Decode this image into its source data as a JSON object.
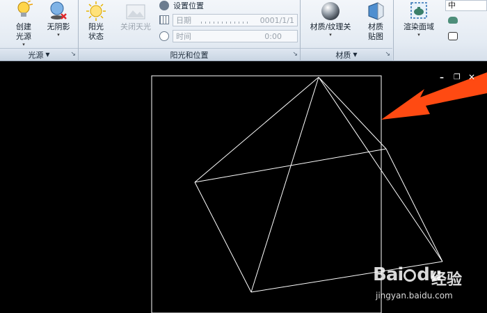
{
  "ribbon": {
    "light_panel": {
      "title": "光源",
      "create_light": "创建\n光源",
      "no_shadow": "无阴影"
    },
    "sun_panel": {
      "title": "阳光和位置",
      "sun_status": "阳光\n状态",
      "sky_off": "关闭天光",
      "set_location": "设置位置",
      "date_label": "日期",
      "date_value": "0001/1/1",
      "time_label": "时间",
      "time_value": "0:00"
    },
    "material_panel": {
      "title": "材质",
      "materials_textures": "材质/纹理关",
      "material_mapping": "材质\n贴图"
    },
    "render_panel": {
      "render_region": "渲染面域",
      "quality_value": "中"
    }
  },
  "viewport": {
    "controls": {
      "minimize": "–",
      "restore": "❐",
      "close": "✕"
    }
  },
  "watermark": {
    "logo": "Bai",
    "logo_du": "du",
    "brand": "经验",
    "url": "jingyan.baidu.com"
  },
  "colors": {
    "arrow": "#ff4a12",
    "wireframe": "#ffffff",
    "background": "#000000"
  },
  "icons": [
    "lightbulb-icon",
    "no-shadow-icon",
    "sun-icon",
    "sky-icon",
    "globe-icon",
    "calendar-icon",
    "clock-icon",
    "sphere-icon",
    "material-map-icon",
    "render-teapot-icon",
    "launcher-icon",
    "arrow-pointer-icon"
  ]
}
